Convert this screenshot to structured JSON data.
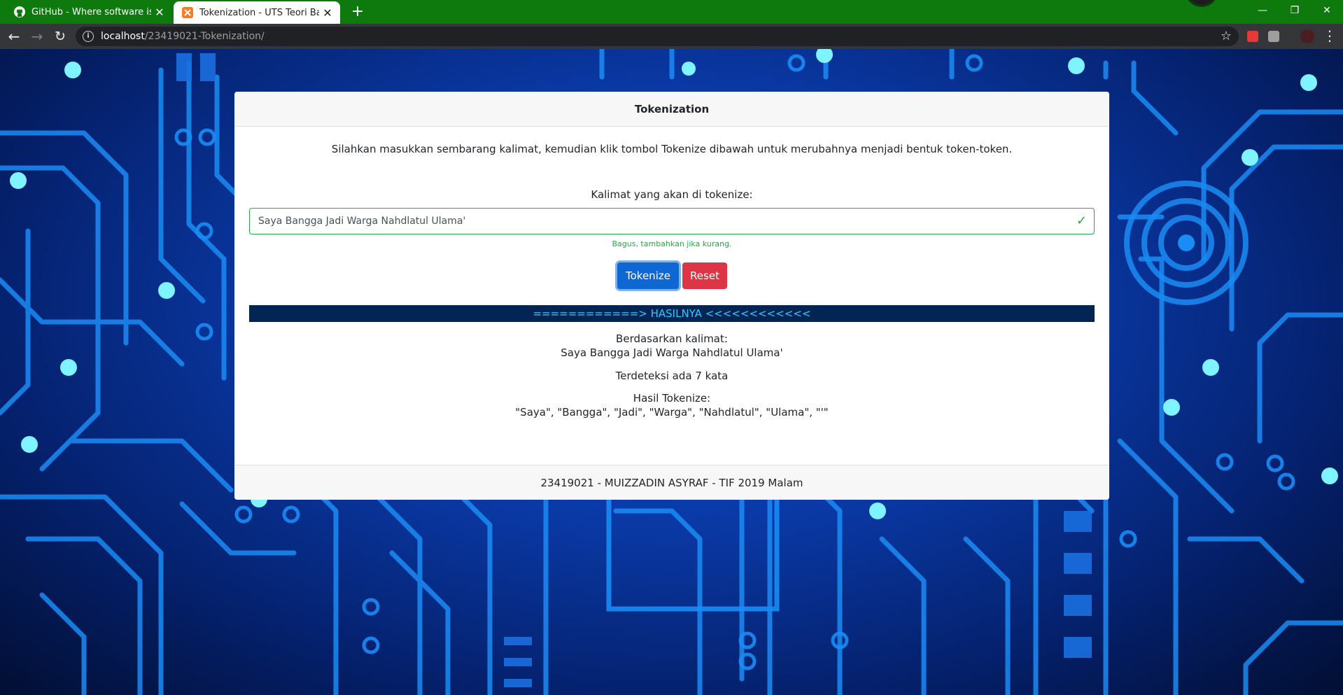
{
  "browser": {
    "tabs": [
      {
        "title": "GitHub - Where software is built",
        "icon": "github-icon",
        "active": false
      },
      {
        "title": "Tokenization - UTS Teori Bahasa",
        "icon": "xampp-icon",
        "active": true
      }
    ],
    "new_tab_label": "+",
    "url": {
      "host": "localhost",
      "path": "/23419021-Tokenization/"
    },
    "window_controls": {
      "minimize": "—",
      "maximize": "❐",
      "close": "✕"
    },
    "colors": {
      "tab_strip": "#0e7a0e",
      "toolbar": "#35363a"
    }
  },
  "card": {
    "header": "Tokenization",
    "intro": "Silahkan masukkan sembarang kalimat, kemudian klik tombol Tokenize dibawah untuk merubahnya menjadi bentuk token-token.",
    "input_label": "Kalimat yang akan di tokenize:",
    "input_value": "Saya Bangga Jadi Warga Nahdlatul Ulama'",
    "valid_feedback": "Bagus, tambahkan jika kurang.",
    "buttons": {
      "tokenize": "Tokenize",
      "reset": "Reset"
    },
    "result_bar": "============> HASILNYA <<<<<<<<<<<<",
    "result": {
      "based_on_label": "Berdasarkan kalimat:",
      "sentence": "Saya Bangga Jadi Warga Nahdlatul Ulama'",
      "word_count_text": "Terdeteksi ada 7 kata",
      "tokens_label": "Hasil Tokenize:",
      "tokens_text": "\"Saya\", \"Bangga\", \"Jadi\", \"Warga\", \"Nahdlatul\", \"Ulama\", \"'\""
    },
    "footer": "23419021 - MUIZZADIN ASYRAF - TIF 2019 Malam"
  },
  "colors": {
    "primary": "#0e67d2",
    "danger": "#dc3545",
    "success": "#28a745",
    "result_bar_bg": "#022553",
    "result_bar_text": "#2ecaff"
  }
}
